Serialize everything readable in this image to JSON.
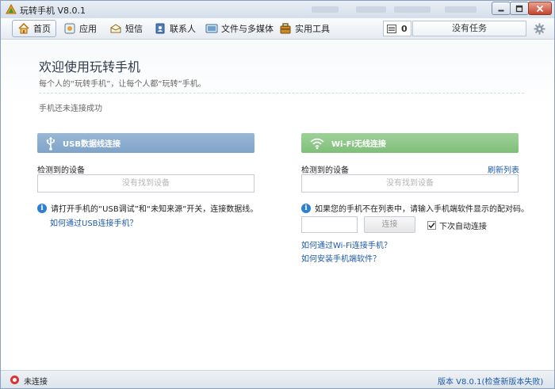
{
  "window": {
    "title": "玩转手机 V8.0.1"
  },
  "toolbar": {
    "items": [
      {
        "label": "首页",
        "icon": "home-icon"
      },
      {
        "label": "应用",
        "icon": "apps-icon"
      },
      {
        "label": "短信",
        "icon": "sms-icon"
      },
      {
        "label": "联系人",
        "icon": "contacts-icon"
      },
      {
        "label": "文件与多媒体",
        "icon": "media-icon"
      },
      {
        "label": "实用工具",
        "icon": "toolbox-icon"
      }
    ],
    "task_count": "0",
    "task_status": "没有任务"
  },
  "welcome": {
    "title": "欢迎使用玩转手机",
    "subtitle": "每个人的“玩转手机”，让每个人都“玩转”手机。",
    "status": "手机还未连接成功"
  },
  "usb": {
    "header": "USB数据线连接",
    "devices_label": "检测到的设备",
    "no_device": "没有找到设备",
    "info": "请打开手机的“USB调试”和“未知来源”开关，连接数据线。",
    "help_link": "如何通过USB连接手机？"
  },
  "wifi": {
    "header": "Wi-Fi无线连接",
    "devices_label": "检测到的设备",
    "refresh": "刷新列表",
    "no_device": "没有找到设备",
    "info": "如果您的手机不在列表中，请输入手机端软件显示的配对码。",
    "code_value": "",
    "connect_label": "连接",
    "auto_connect_label": "下次自动连接",
    "auto_connect_checked": true,
    "help_link_1": "如何通过Wi-Fi连接手机？",
    "help_link_2": "如何安装手机端软件？"
  },
  "statusbar": {
    "connection": "未连接",
    "version": "版本 V8.0.1(检查新版本失败)"
  },
  "colors": {
    "usb_header": "#8badcf",
    "wifi_header": "#8fc889",
    "link": "#1e5aa8"
  }
}
